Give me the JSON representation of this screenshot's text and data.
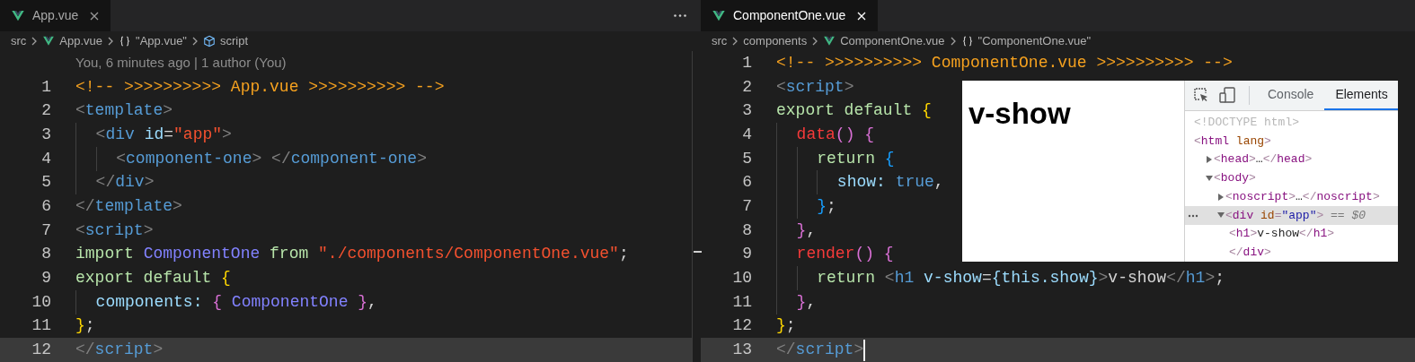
{
  "editors": [
    {
      "tab_label": "App.vue",
      "focused": false,
      "more_actions": true,
      "breadcrumbs": [
        {
          "label": "src",
          "kind": "folder"
        },
        {
          "label": "App.vue",
          "kind": "file"
        },
        {
          "label": "\"App.vue\"",
          "kind": "object"
        },
        {
          "label": "script",
          "kind": "element"
        }
      ],
      "blame": "You, 6 minutes ago | 1 author (You)",
      "lines": [
        {
          "number": "1",
          "current": false,
          "tokens": [
            {
              "text": "<!-- >>>>>>>>>> App.vue >>>>>>>>>> -->",
              "kind": "comment"
            }
          ]
        },
        {
          "number": "2",
          "current": false,
          "tokens": [
            {
              "text": "<",
              "kind": "punct"
            },
            {
              "text": "template",
              "kind": "tag"
            },
            {
              "text": ">",
              "kind": "punct"
            }
          ]
        },
        {
          "number": "3",
          "current": false,
          "tokens": [
            {
              "text": "  <",
              "kind": "punct"
            },
            {
              "text": "div",
              "kind": "tag"
            },
            {
              "text": " id",
              "kind": "attr"
            },
            {
              "text": "=",
              "kind": "plain"
            },
            {
              "text": "\"app\"",
              "kind": "string"
            },
            {
              "text": ">",
              "kind": "punct"
            }
          ]
        },
        {
          "number": "4",
          "current": false,
          "tokens": [
            {
              "text": "    <",
              "kind": "punct"
            },
            {
              "text": "component-one",
              "kind": "tag"
            },
            {
              "text": ">",
              "kind": "punct"
            },
            {
              "text": " </",
              "kind": "punct"
            },
            {
              "text": "component-one",
              "kind": "tag"
            },
            {
              "text": ">",
              "kind": "punct"
            }
          ]
        },
        {
          "number": "5",
          "current": false,
          "tokens": [
            {
              "text": "  </",
              "kind": "punct"
            },
            {
              "text": "div",
              "kind": "tag"
            },
            {
              "text": ">",
              "kind": "punct"
            }
          ]
        },
        {
          "number": "6",
          "current": false,
          "tokens": [
            {
              "text": "</",
              "kind": "punct"
            },
            {
              "text": "template",
              "kind": "tag"
            },
            {
              "text": ">",
              "kind": "punct"
            }
          ]
        },
        {
          "number": "7",
          "current": false,
          "tokens": [
            {
              "text": "<",
              "kind": "punct"
            },
            {
              "text": "script",
              "kind": "tag"
            },
            {
              "text": ">",
              "kind": "punct"
            }
          ]
        },
        {
          "number": "8",
          "current": false,
          "tokens": [
            {
              "text": "import ",
              "kind": "keyword"
            },
            {
              "text": "ComponentOne",
              "kind": "type"
            },
            {
              "text": " from ",
              "kind": "keyword"
            },
            {
              "text": "\"./components/ComponentOne.vue\"",
              "kind": "string"
            },
            {
              "text": ";",
              "kind": "plain"
            }
          ]
        },
        {
          "number": "9",
          "current": false,
          "tokens": [
            {
              "text": "export default ",
              "kind": "keyword"
            },
            {
              "text": "{",
              "kind": "brace1"
            }
          ]
        },
        {
          "number": "10",
          "current": false,
          "tokens": [
            {
              "text": "  components: ",
              "kind": "property"
            },
            {
              "text": "{ ",
              "kind": "brace2"
            },
            {
              "text": "ComponentOne",
              "kind": "type"
            },
            {
              "text": " }",
              "kind": "brace2"
            },
            {
              "text": ",",
              "kind": "plain"
            }
          ]
        },
        {
          "number": "11",
          "current": false,
          "tokens": [
            {
              "text": "}",
              "kind": "brace1"
            },
            {
              "text": ";",
              "kind": "plain"
            }
          ]
        },
        {
          "number": "12",
          "current": true,
          "tokens": [
            {
              "text": "</",
              "kind": "punct"
            },
            {
              "text": "script",
              "kind": "tag"
            },
            {
              "text": ">",
              "kind": "punct"
            }
          ]
        }
      ]
    },
    {
      "tab_label": "ComponentOne.vue",
      "focused": true,
      "more_actions": false,
      "breadcrumbs": [
        {
          "label": "src",
          "kind": "folder"
        },
        {
          "label": "components",
          "kind": "folder"
        },
        {
          "label": "ComponentOne.vue",
          "kind": "file"
        },
        {
          "label": "\"ComponentOne.vue\"",
          "kind": "object"
        }
      ],
      "lines": [
        {
          "number": "1",
          "current": false,
          "tokens": [
            {
              "text": "<!-- >>>>>>>>>> ComponentOne.vue >>>>>>>>>> -->",
              "kind": "comment"
            }
          ]
        },
        {
          "number": "2",
          "current": false,
          "tokens": [
            {
              "text": "<",
              "kind": "punct"
            },
            {
              "text": "script",
              "kind": "tag"
            },
            {
              "text": ">",
              "kind": "punct"
            }
          ]
        },
        {
          "number": "3",
          "current": false,
          "tokens": [
            {
              "text": "export default ",
              "kind": "keyword"
            },
            {
              "text": "{",
              "kind": "brace1"
            }
          ]
        },
        {
          "number": "4",
          "current": false,
          "tokens": [
            {
              "text": "  data",
              "kind": "method"
            },
            {
              "text": "()",
              "kind": "brace2"
            },
            {
              "text": " {",
              "kind": "brace2"
            }
          ]
        },
        {
          "number": "5",
          "current": false,
          "tokens": [
            {
              "text": "    return ",
              "kind": "keyword"
            },
            {
              "text": "{",
              "kind": "brace3"
            }
          ]
        },
        {
          "number": "6",
          "current": false,
          "tokens": [
            {
              "text": "      show: ",
              "kind": "property"
            },
            {
              "text": "true",
              "kind": "constant"
            },
            {
              "text": ",",
              "kind": "plain"
            }
          ]
        },
        {
          "number": "7",
          "current": false,
          "tokens": [
            {
              "text": "    }",
              "kind": "brace3"
            },
            {
              "text": ";",
              "kind": "plain"
            }
          ]
        },
        {
          "number": "8",
          "current": false,
          "tokens": [
            {
              "text": "  }",
              "kind": "brace2"
            },
            {
              "text": ",",
              "kind": "plain"
            }
          ]
        },
        {
          "number": "9",
          "current": false,
          "tokens": [
            {
              "text": "  render",
              "kind": "method"
            },
            {
              "text": "()",
              "kind": "brace2"
            },
            {
              "text": " {",
              "kind": "brace2"
            }
          ]
        },
        {
          "number": "10",
          "current": false,
          "tokens": [
            {
              "text": "    return ",
              "kind": "keyword"
            },
            {
              "text": "<",
              "kind": "punct"
            },
            {
              "text": "h1",
              "kind": "tag"
            },
            {
              "text": " v-show",
              "kind": "attr"
            },
            {
              "text": "=",
              "kind": "plain"
            },
            {
              "text": "{this.show}",
              "kind": "attr"
            },
            {
              "text": ">",
              "kind": "punct"
            },
            {
              "text": "v-show",
              "kind": "plain"
            },
            {
              "text": "</",
              "kind": "punct"
            },
            {
              "text": "h1",
              "kind": "tag"
            },
            {
              "text": ">",
              "kind": "punct"
            },
            {
              "text": ";",
              "kind": "plain"
            }
          ]
        },
        {
          "number": "11",
          "current": false,
          "tokens": [
            {
              "text": "  }",
              "kind": "brace2"
            },
            {
              "text": ",",
              "kind": "plain"
            }
          ]
        },
        {
          "number": "12",
          "current": false,
          "tokens": [
            {
              "text": "}",
              "kind": "brace1"
            },
            {
              "text": ";",
              "kind": "plain"
            }
          ]
        },
        {
          "number": "13",
          "current": true,
          "tokens": [
            {
              "text": "</",
              "kind": "punct"
            },
            {
              "text": "script",
              "kind": "tag"
            },
            {
              "text": ">",
              "kind": "punct"
            }
          ]
        }
      ]
    }
  ],
  "browser_preview": {
    "page_heading": "v-show",
    "devtools": {
      "tabs": [
        {
          "label": "Console",
          "selected": false
        },
        {
          "label": "Elements",
          "selected": true
        }
      ],
      "tree": [
        {
          "selected": false,
          "tokens": [
            {
              "text": "<!DOCTYPE html>",
              "kind": "doctype"
            }
          ]
        },
        {
          "selected": false,
          "tokens": [
            {
              "text": "<",
              "kind": "bracket"
            },
            {
              "text": "html",
              "kind": "tag"
            },
            {
              "text": " lang",
              "kind": "attr"
            },
            {
              "text": ">",
              "kind": "bracket"
            }
          ],
          "children": [
            {
              "selected": false,
              "expanded": false,
              "tokens": [
                {
                  "text": "<",
                  "kind": "bracket"
                },
                {
                  "text": "head",
                  "kind": "tag"
                },
                {
                  "text": ">",
                  "kind": "bracket"
                },
                {
                  "text": "…",
                  "kind": "text"
                },
                {
                  "text": "</",
                  "kind": "bracket"
                },
                {
                  "text": "head",
                  "kind": "tag"
                },
                {
                  "text": ">",
                  "kind": "bracket"
                }
              ]
            },
            {
              "selected": false,
              "expanded": true,
              "tokens": [
                {
                  "text": "<",
                  "kind": "bracket"
                },
                {
                  "text": "body",
                  "kind": "tag"
                },
                {
                  "text": ">",
                  "kind": "bracket"
                }
              ],
              "children": [
                {
                  "selected": false,
                  "expanded": false,
                  "tokens": [
                    {
                      "text": "<",
                      "kind": "bracket"
                    },
                    {
                      "text": "noscript",
                      "kind": "tag"
                    },
                    {
                      "text": ">",
                      "kind": "bracket"
                    },
                    {
                      "text": "…",
                      "kind": "text"
                    },
                    {
                      "text": "</",
                      "kind": "bracket"
                    },
                    {
                      "text": "noscript",
                      "kind": "tag"
                    },
                    {
                      "text": ">",
                      "kind": "bracket"
                    }
                  ]
                },
                {
                  "selected": true,
                  "expanded": true,
                  "tokens": [
                    {
                      "text": "<",
                      "kind": "bracket"
                    },
                    {
                      "text": "div",
                      "kind": "tag"
                    },
                    {
                      "text": " id",
                      "kind": "attr"
                    },
                    {
                      "text": "=",
                      "kind": "bracket"
                    },
                    {
                      "text": "\"app\"",
                      "kind": "value"
                    },
                    {
                      "text": ">",
                      "kind": "bracket"
                    },
                    {
                      "text": " == $0",
                      "kind": "hint"
                    }
                  ],
                  "children": [
                    {
                      "selected": false,
                      "tokens": [
                        {
                          "text": "<",
                          "kind": "bracket"
                        },
                        {
                          "text": "h1",
                          "kind": "tag"
                        },
                        {
                          "text": ">",
                          "kind": "bracket"
                        },
                        {
                          "text": "v-show",
                          "kind": "text"
                        },
                        {
                          "text": "</",
                          "kind": "bracket"
                        },
                        {
                          "text": "h1",
                          "kind": "tag"
                        },
                        {
                          "text": ">",
                          "kind": "bracket"
                        }
                      ]
                    }
                  ],
                  "close_tokens": [
                    {
                      "text": "</",
                      "kind": "bracket"
                    },
                    {
                      "text": "div",
                      "kind": "tag"
                    },
                    {
                      "text": ">",
                      "kind": "bracket"
                    }
                  ]
                }
              ]
            }
          ]
        }
      ]
    }
  }
}
